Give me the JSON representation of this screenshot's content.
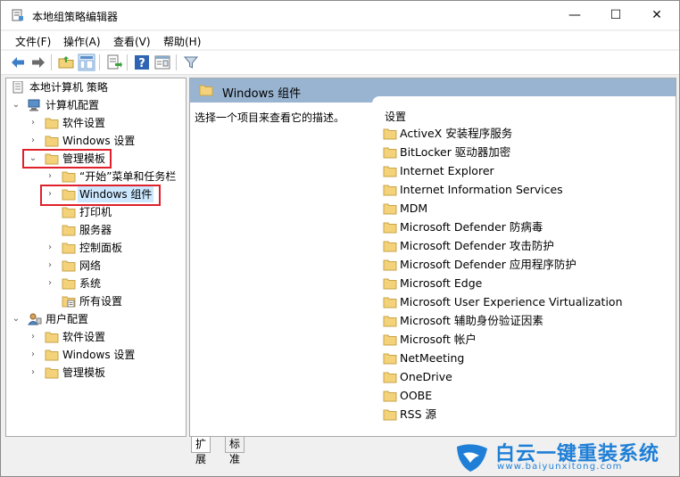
{
  "window": {
    "title": "本地组策略编辑器"
  },
  "window_controls": {
    "minimize": "—",
    "maximize": "☐",
    "close": "✕"
  },
  "menubar": {
    "items": [
      "文件(F)",
      "操作(A)",
      "查看(V)",
      "帮助(H)"
    ]
  },
  "toolbar": {
    "buttons": [
      "back-arrow-icon",
      "forward-arrow-icon",
      "up-folder-icon",
      "show-hide-tree-icon",
      "export-list-icon",
      "help-icon",
      "properties-icon",
      "filter-icon"
    ]
  },
  "tree": {
    "root": "本地计算机 策略",
    "computer_config": "计算机配置",
    "cc_software": "软件设置",
    "cc_windows": "Windows 设置",
    "cc_admin": "管理模板",
    "start_menu": "“开始”菜单和任务栏",
    "windows_components": "Windows 组件",
    "printers": "打印机",
    "servers": "服务器",
    "control_panel": "控制面板",
    "network": "网络",
    "system": "系统",
    "all_settings": "所有设置",
    "user_config": "用户配置",
    "uc_software": "软件设置",
    "uc_windows": "Windows 设置",
    "uc_admin": "管理模板"
  },
  "right": {
    "header": "Windows 组件",
    "description": "选择一个项目来查看它的描述。",
    "list_header": "设置",
    "items": [
      "ActiveX 安装程序服务",
      "BitLocker 驱动器加密",
      "Internet Explorer",
      "Internet Information Services",
      "MDM",
      "Microsoft Defender 防病毒",
      "Microsoft Defender 攻击防护",
      "Microsoft Defender 应用程序防护",
      "Microsoft Edge",
      "Microsoft User Experience Virtualization",
      "Microsoft 辅助身份验证因素",
      "Microsoft 帐户",
      "NetMeeting",
      "OneDrive",
      "OOBE",
      "RSS 源"
    ]
  },
  "tabs": {
    "extended": "扩展",
    "standard": "标准"
  },
  "watermark": {
    "title": "白云一键重装系统",
    "url": "www.baiyunxitong.com"
  },
  "colors": {
    "header_bg": "#99b4d1",
    "selection_bg": "#cce8ff",
    "highlight_box": "#e0202a",
    "watermark_blue": "#1f7fd6",
    "folder_yellow": "#f3d27a"
  }
}
